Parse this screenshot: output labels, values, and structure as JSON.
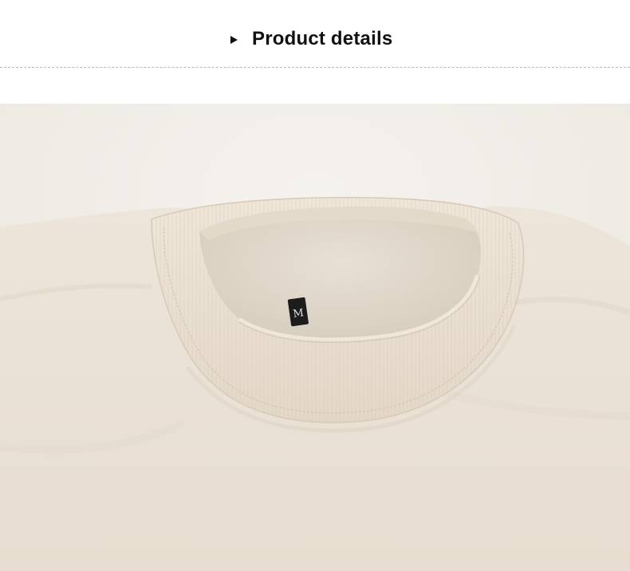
{
  "header": {
    "title": "Product details",
    "bullet_icon": "triangle-right-icon"
  },
  "product_photo": {
    "size_label": "M",
    "colors": {
      "fabric": "#ede5da",
      "rib_collar": "#e8dece",
      "background": "#f1eee9",
      "label": "#1c1c1c"
    }
  }
}
